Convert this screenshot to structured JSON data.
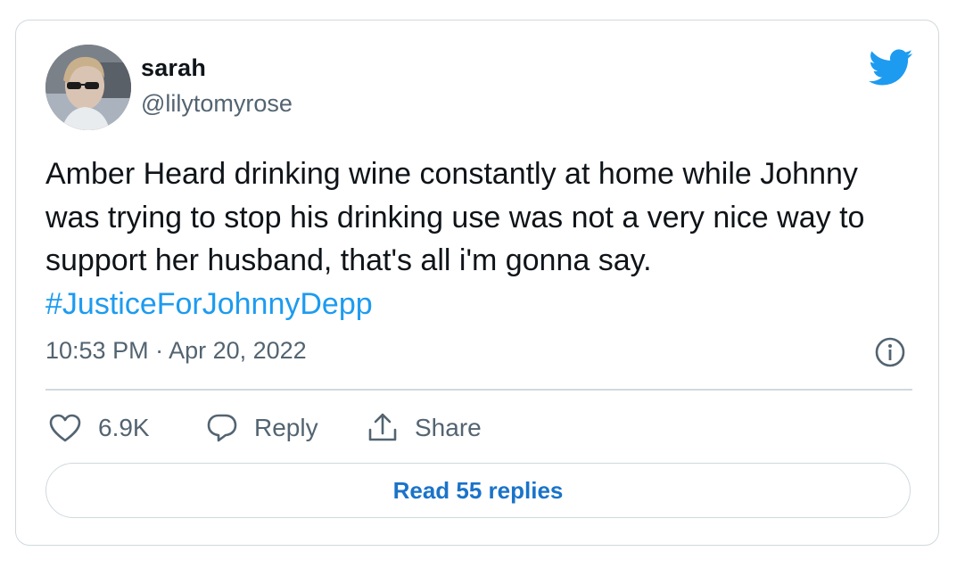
{
  "author": {
    "display_name": "sarah",
    "handle": "@lilytomyrose",
    "avatar_icon": "profile-photo"
  },
  "tweet": {
    "text": "Amber Heard drinking wine constantly at home while Johnny was trying to stop his drinking use was not a very nice way to support her husband, that's all i'm gonna say.",
    "hashtag": "#JusticeForJohnnyDepp",
    "timestamp": "10:53 PM · Apr 20, 2022"
  },
  "actions": {
    "like_count": "6.9K",
    "reply_label": "Reply",
    "share_label": "Share"
  },
  "read_replies_label": "Read 55 replies",
  "colors": {
    "brand_blue": "#1d9bf0",
    "link_blue": "#1a73c9",
    "text_primary": "#0f1419",
    "text_secondary": "#536471",
    "border": "#cfd9de"
  },
  "icons": [
    "twitter-bird-icon",
    "info-icon",
    "heart-icon",
    "reply-bubble-icon",
    "share-upload-icon"
  ]
}
